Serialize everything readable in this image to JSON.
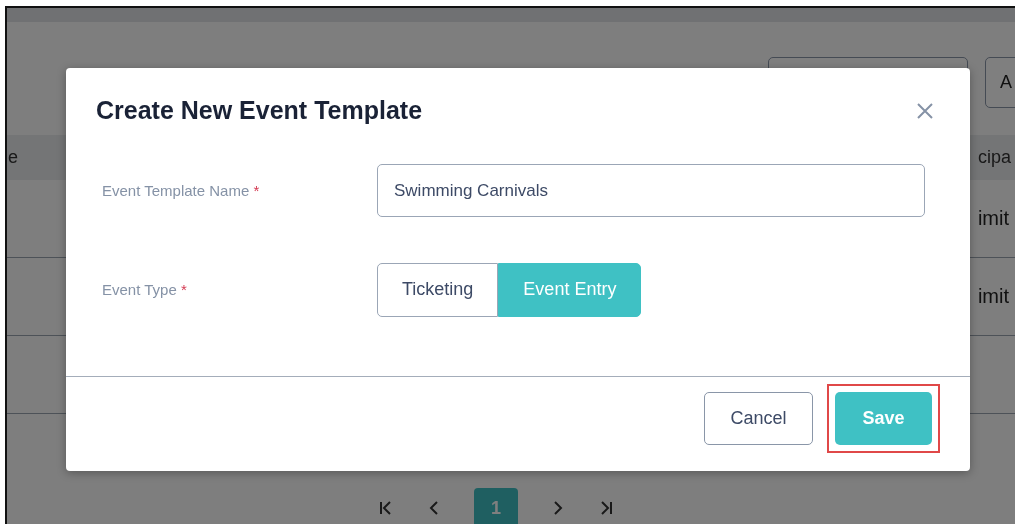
{
  "background": {
    "toolbar_button": "A",
    "table": {
      "columns": [
        "e",
        "cipa"
      ],
      "rows": [
        {
          "cell": "imit"
        },
        {
          "cell": "imit"
        }
      ]
    },
    "pagination": {
      "pages": [
        {
          "label": "1",
          "selected": true
        }
      ]
    }
  },
  "dialog": {
    "title": "Create New Event Template",
    "fields": [
      {
        "kind": "text",
        "label": "Event Template Name",
        "required_mark": "*",
        "value": "Swimming Carnivals"
      },
      {
        "kind": "toggle",
        "label": "Event Type",
        "required_mark": "*",
        "options": [
          {
            "label": "Ticketing",
            "selected": false
          },
          {
            "label": "Event Entry",
            "selected": true
          }
        ]
      }
    ],
    "buttons": [
      {
        "label": "Cancel",
        "kind": "secondary",
        "highlighted": false
      },
      {
        "label": "Save",
        "kind": "primary",
        "highlighted": true
      }
    ]
  }
}
